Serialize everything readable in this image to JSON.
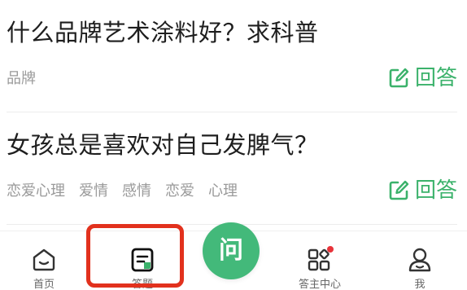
{
  "questions": [
    {
      "title": "什么品牌艺术涂料好？求科普",
      "tags": [
        "品牌"
      ],
      "answer_label": "回答"
    },
    {
      "title": "女孩总是喜欢对自己发脾气？",
      "tags": [
        "恋爱心理",
        "爱情",
        "感情",
        "恋爱",
        "心理"
      ],
      "answer_label": "回答"
    }
  ],
  "tabbar": {
    "home_label": "首页",
    "answer_label": "答题",
    "ask_label": "问",
    "host_label": "答主中心",
    "me_label": "我"
  },
  "colors": {
    "accent": "#3bb26b",
    "ask_button": "#43b97a",
    "highlight_box": "#e2311d",
    "notification_dot": "#e8333a"
  },
  "icons": {
    "answer": "edit-square-icon",
    "home": "home-icon",
    "answer_tab": "document-icon",
    "host": "grid-apps-icon",
    "me": "user-icon"
  }
}
